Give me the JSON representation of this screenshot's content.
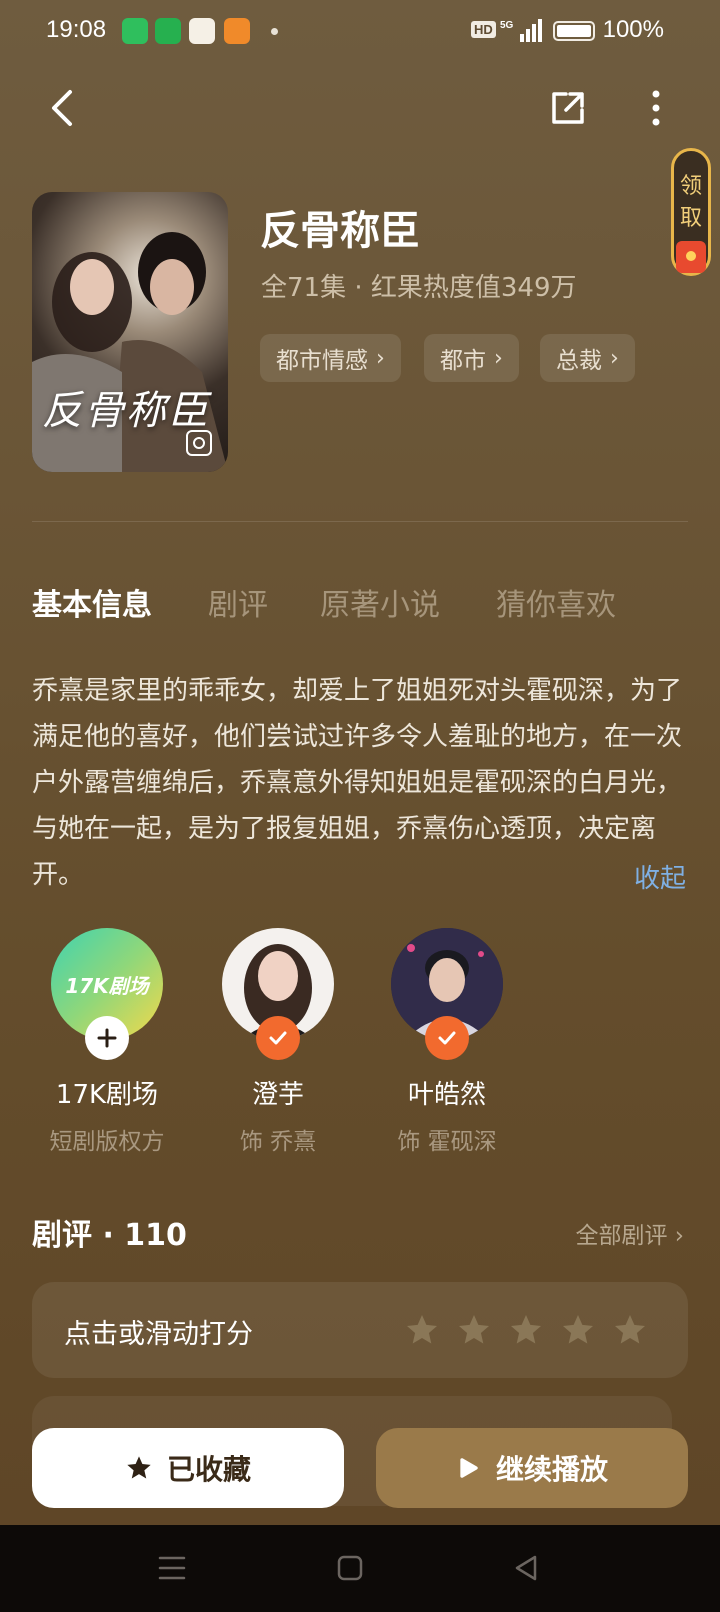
{
  "status_bar": {
    "time": "19:08",
    "network": "5G",
    "battery": "100%"
  },
  "colors": {
    "accent_orange": "#f26a2e",
    "link_blue": "#7fb0e4",
    "play_button": "#9a7a4a"
  },
  "drama": {
    "title": "反骨称臣",
    "cover_title": "反骨称臣",
    "meta": "全71集 · 红果热度值349万",
    "tags": [
      {
        "label": "都市情感"
      },
      {
        "label": "都市"
      },
      {
        "label": "总裁"
      }
    ]
  },
  "reward": {
    "label_line1": "领",
    "label_line2": "取"
  },
  "tabs": [
    {
      "label": "基本信息",
      "active": true
    },
    {
      "label": "剧评"
    },
    {
      "label": "原著小说"
    },
    {
      "label": "猜你喜欢"
    }
  ],
  "description": {
    "text": "乔熹是家里的乖乖女，却爱上了姐姐死对头霍砚深，为了满足他的喜好，他们尝试过许多令人羞耻的地方，在一次户外露营缠绵后，乔熹意外得知姐姐是霍砚深的白月光，与她在一起，是为了报复姐姐，乔熹伤心透顶，决定离开。",
    "collapse_label": "收起"
  },
  "people": [
    {
      "name": "17K剧场",
      "role": "短剧版权方",
      "avatar_text": "17K剧场",
      "badge": "plus-icon"
    },
    {
      "name": "澄芋",
      "role": "饰 乔熹",
      "badge": "check-icon"
    },
    {
      "name": "叶皓然",
      "role": "饰 霍砚深",
      "badge": "check-icon"
    }
  ],
  "reviews": {
    "title": "剧评 · 110",
    "all_label": "全部剧评 ›",
    "rate_prompt": "点击或滑动打分",
    "star_count": 5
  },
  "actions": {
    "favorite_label": "已收藏",
    "play_label": "继续播放"
  }
}
